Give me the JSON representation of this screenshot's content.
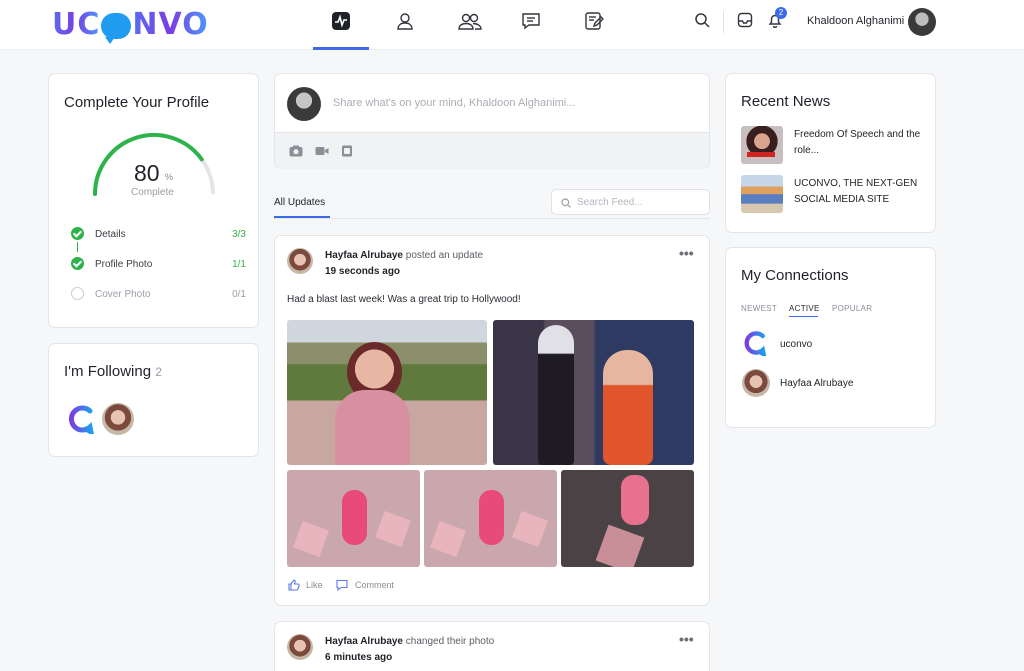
{
  "brand": {
    "logo_text_left": "UC",
    "logo_text_right": "NVO"
  },
  "topnav": {
    "items": [
      {
        "name": "activity",
        "icon": "pulse-icon",
        "active": true
      },
      {
        "name": "profile",
        "icon": "user-icon"
      },
      {
        "name": "connections",
        "icon": "users-icon"
      },
      {
        "name": "messages",
        "icon": "chat-icon"
      },
      {
        "name": "notes",
        "icon": "edit-icon"
      }
    ],
    "notification_count": "2",
    "user_name": "Khaldoon Alghanimi"
  },
  "profile_completion": {
    "title": "Complete Your Profile",
    "percent": "80",
    "percent_symbol": "%",
    "percent_value": 0.8,
    "label": "Complete",
    "steps": [
      {
        "label": "Details",
        "count": "3/3",
        "done": true
      },
      {
        "label": "Profile Photo",
        "count": "1/1",
        "done": true
      },
      {
        "label": "Cover Photo",
        "count": "0/1",
        "done": false
      }
    ]
  },
  "following": {
    "title": "I'm Following",
    "count": "2"
  },
  "composer": {
    "placeholder": "Share what's on your mind, Khaldoon Alghanimi..."
  },
  "feed": {
    "tab_all": "All Updates",
    "search_placeholder": "Search Feed...",
    "posts": [
      {
        "author": "Hayfaa Alrubaye",
        "action": "posted an update",
        "time": "19 seconds ago",
        "text": "Had a blast last week! Was a great trip to Hollywood!",
        "like_label": "Like",
        "comment_label": "Comment"
      },
      {
        "author": "Hayfaa Alrubaye",
        "action": "changed their photo",
        "time": "6 minutes ago"
      }
    ],
    "more_label": "•••"
  },
  "recent_news": {
    "title": "Recent News",
    "items": [
      {
        "title": "Freedom Of Speech and the role..."
      },
      {
        "title": "UCONVO, THE NEXT-GEN SOCIAL MEDIA SITE"
      }
    ]
  },
  "connections": {
    "title": "My Connections",
    "tabs": [
      "NEWEST",
      "ACTIVE",
      "POPULAR"
    ],
    "active_tab": "ACTIVE",
    "items": [
      {
        "name": "uconvo"
      },
      {
        "name": "Hayfaa Alrubaye"
      }
    ]
  },
  "colors": {
    "accent": "#3d6be8",
    "success": "#2db34a"
  }
}
